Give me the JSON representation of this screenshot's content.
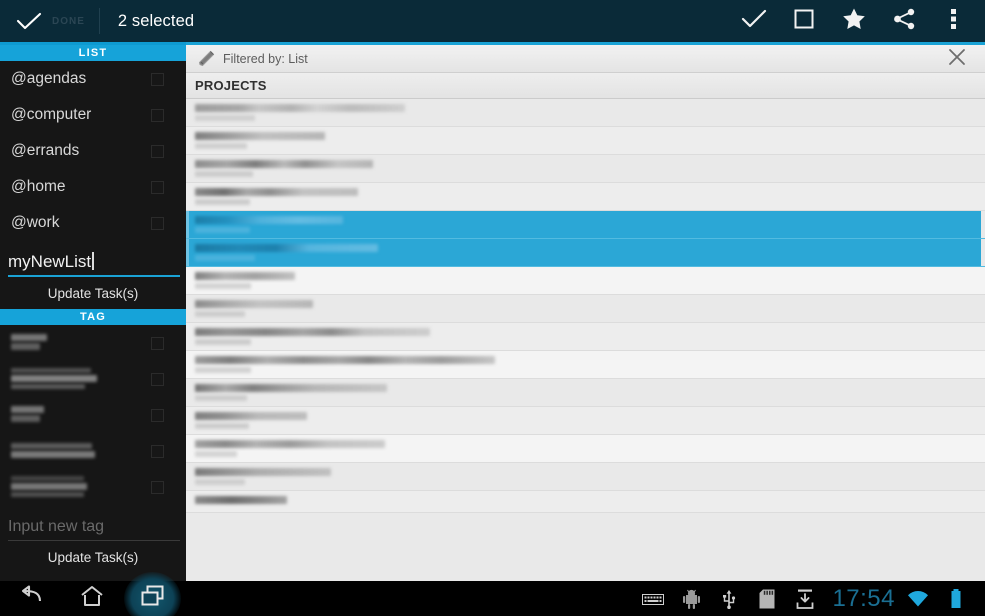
{
  "actionbar": {
    "done_label": "DONE",
    "done_icon": "check-icon",
    "title": "2 selected",
    "icons": [
      {
        "name": "confirm-check-icon",
        "label": "Confirm"
      },
      {
        "name": "select-all-square-icon",
        "label": "Select all"
      },
      {
        "name": "star-icon",
        "label": "Star"
      },
      {
        "name": "share-icon",
        "label": "Share"
      },
      {
        "name": "overflow-menu-icon",
        "label": "More options"
      }
    ]
  },
  "sidebar": {
    "list_section": {
      "header": "LIST",
      "items": [
        {
          "label": "@agendas",
          "checked": false
        },
        {
          "label": "@computer",
          "checked": false
        },
        {
          "label": "@errands",
          "checked": false
        },
        {
          "label": "@home",
          "checked": false
        },
        {
          "label": "@work",
          "checked": false
        }
      ],
      "new_list_value": "myNewList",
      "update_button": "Update Task(s)"
    },
    "tag_section": {
      "header": "TAG",
      "items": [
        {
          "label": "",
          "redacted": true,
          "checked": false
        },
        {
          "label": "",
          "redacted": true,
          "checked": false
        },
        {
          "label": "",
          "redacted": true,
          "checked": false
        },
        {
          "label": "",
          "redacted": true,
          "checked": false
        },
        {
          "label": "",
          "redacted": true,
          "checked": false
        }
      ],
      "new_tag_placeholder": "Input new tag",
      "update_button": "Update Task(s)"
    }
  },
  "pane": {
    "filter_icon": "edit-pencil-icon",
    "filter_text": "Filtered by: List",
    "close_icon": "close-x-icon",
    "group_header": "PROJECTS",
    "rows": [
      {
        "selected": false,
        "redacted": true
      },
      {
        "selected": false,
        "redacted": true
      },
      {
        "selected": false,
        "redacted": true
      },
      {
        "selected": false,
        "redacted": true
      },
      {
        "selected": true,
        "redacted": true
      },
      {
        "selected": true,
        "redacted": true
      },
      {
        "selected": false,
        "redacted": true
      },
      {
        "selected": false,
        "redacted": true
      },
      {
        "selected": false,
        "redacted": true
      },
      {
        "selected": false,
        "redacted": true
      },
      {
        "selected": false,
        "redacted": true
      },
      {
        "selected": false,
        "redacted": true
      },
      {
        "selected": false,
        "redacted": true
      },
      {
        "selected": false,
        "redacted": true
      },
      {
        "selected": false,
        "redacted": true
      }
    ]
  },
  "navbar": {
    "buttons": [
      {
        "name": "back-icon",
        "label": "Back"
      },
      {
        "name": "home-icon",
        "label": "Home"
      },
      {
        "name": "recent-apps-icon",
        "label": "Recent apps"
      }
    ],
    "status_icons": [
      {
        "name": "keyboard-icon"
      },
      {
        "name": "android-debug-icon"
      },
      {
        "name": "usb-icon"
      },
      {
        "name": "sd-card-icon"
      },
      {
        "name": "download-icon"
      }
    ],
    "clock": "17:54",
    "wifi_icon": "wifi-icon",
    "battery_icon": "battery-icon"
  },
  "colors": {
    "accent_blue": "#1aa3d6",
    "selection_blue": "#2ba7d6",
    "actionbar_dark": "#0a2a38",
    "sidebar_dark": "#161616",
    "clock_blue": "#1a6f93"
  }
}
